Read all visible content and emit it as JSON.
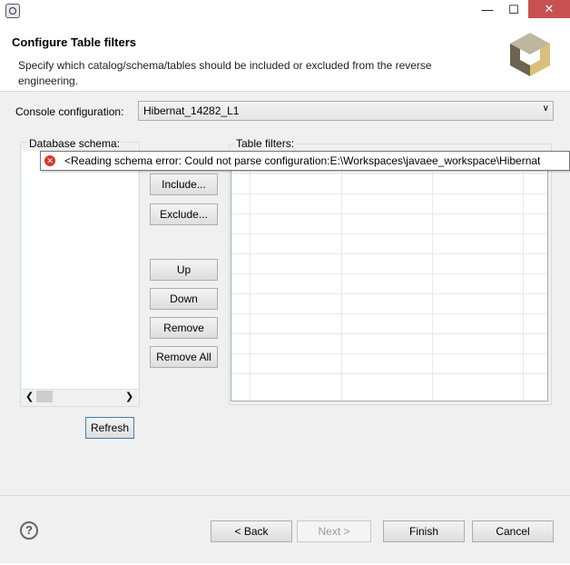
{
  "window": {
    "minimize": "—",
    "maximize": "☐",
    "close": "✕"
  },
  "header": {
    "title": "Configure Table filters",
    "description": "Specify which catalog/schema/tables should be included or excluded from the reverse engineering."
  },
  "console": {
    "label": "Console configuration:",
    "value": "Hibernat_14282_L1"
  },
  "schema": {
    "label": "Database schema:",
    "refresh_label": "Refresh"
  },
  "filters": {
    "label": "Table filters:"
  },
  "buttons": {
    "include": "Include...",
    "exclude": "Exclude...",
    "up": "Up",
    "down": "Down",
    "remove": "Remove",
    "remove_all": "Remove All"
  },
  "tooltip": {
    "text": "<Reading schema error: Could not parse configuration:E:\\Workspaces\\javaee_workspace\\Hibernat"
  },
  "footer": {
    "back": "< Back",
    "next": "Next >",
    "finish": "Finish",
    "cancel": "Cancel"
  },
  "icons": {
    "app": "eclipse-icon",
    "error": "error-icon",
    "help": "help-icon",
    "logo": "hibernate-cube-logo"
  }
}
